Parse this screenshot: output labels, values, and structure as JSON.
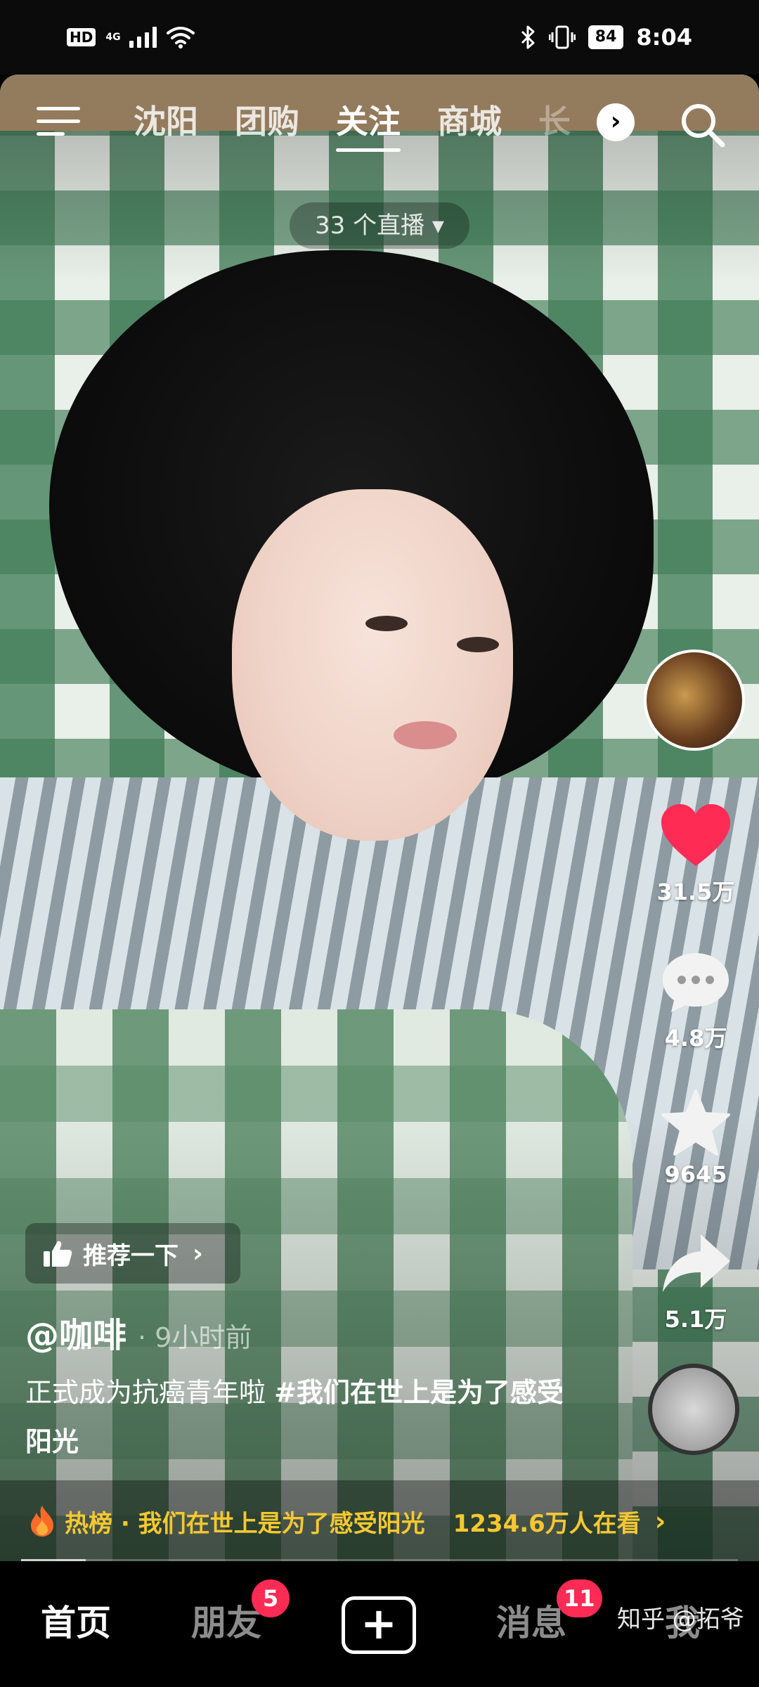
{
  "status_bar": {
    "hd": "HD",
    "network": "4G",
    "battery": "84",
    "time": "8:04",
    "bluetooth_icon": "bluetooth-icon",
    "vibrate_icon": "vibrate-icon"
  },
  "top_nav": {
    "tabs": [
      {
        "label": "沈阳"
      },
      {
        "label": "团购"
      },
      {
        "label": "关注"
      },
      {
        "label": "商城"
      },
      {
        "label": "长"
      }
    ],
    "active_tab": "关注",
    "more_glyph": "›"
  },
  "live_pill": "33 个直播 ▾",
  "rail": {
    "likes": "31.5万",
    "comments": "4.8万",
    "favorites": "9645",
    "shares": "5.1万"
  },
  "recommend": {
    "label": "推荐一下",
    "chevron": "›"
  },
  "post": {
    "author": "@咖啡",
    "time": "· 9小时前",
    "caption_text": "正式成为抗癌青年啦 ",
    "hashtag": "#我们在世上是为了感受阳光"
  },
  "hot_bar": {
    "label": "热榜 · 我们在世上是为了感受阳光",
    "viewers": "1234.6万人在看",
    "chevron": "›"
  },
  "progress": {
    "fraction": 0.09
  },
  "bottom_nav": {
    "home": "首页",
    "friends": "朋友",
    "friends_badge": "5",
    "plus": "+",
    "messages": "消息",
    "messages_badge": "11",
    "me": "我"
  },
  "watermark": "知乎 @拓爷",
  "colors": {
    "like": "#fe2c55",
    "badge": "#fe2c55",
    "hot": "#f5c830"
  }
}
